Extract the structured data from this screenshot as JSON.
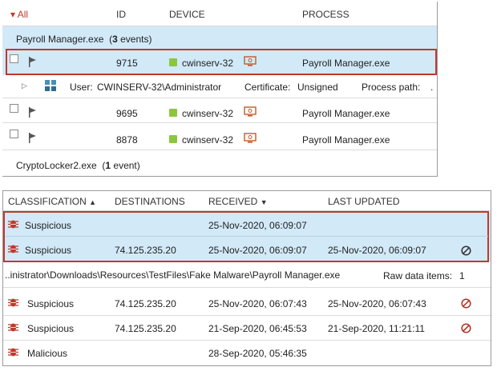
{
  "top": {
    "columns": {
      "all": "All",
      "id": "ID",
      "device": "DEVICE",
      "process": "PROCESS"
    },
    "group1": {
      "name": "Payroll Manager.exe",
      "count_prefix": "(",
      "count": "3",
      "count_suffix": " events)"
    },
    "selected_row": {
      "id": "9715",
      "device": "cwinserv-32",
      "process": "Payroll Manager.exe"
    },
    "details": {
      "user_label": "User:",
      "user_value": "CWINSERV-32\\Administrator",
      "cert_label": "Certificate:",
      "cert_value": "Unsigned",
      "path_label": "Process path:",
      "path_value": "."
    },
    "rows": [
      {
        "id": "9695",
        "device": "cwinserv-32",
        "process": "Payroll Manager.exe"
      },
      {
        "id": "8878",
        "device": "cwinserv-32",
        "process": "Payroll Manager.exe"
      }
    ],
    "group2": {
      "name": "CryptoLocker2.exe",
      "count_prefix": "(",
      "count": "1",
      "count_suffix": " event)"
    }
  },
  "bottom": {
    "columns": {
      "classification": "CLASSIFICATION",
      "destinations": "DESTINATIONS",
      "received": "RECEIVED",
      "last_updated": "LAST UPDATED"
    },
    "sel1": {
      "classification": "Suspicious",
      "destination": "",
      "received": "25-Nov-2020, 06:09:07",
      "updated": ""
    },
    "sel2": {
      "classification": "Suspicious",
      "destination": "74.125.235.20",
      "received": "25-Nov-2020, 06:09:07",
      "updated": "25-Nov-2020, 06:09:07"
    },
    "path_row": {
      "path": "..inistrator\\Downloads\\Resources\\TestFiles\\Fake Malware\\Payroll Manager.exe",
      "raw_label": "Raw data items:",
      "raw_value": "1"
    },
    "rows": [
      {
        "classification": "Suspicious",
        "destination": "74.125.235.20",
        "received": "25-Nov-2020, 06:07:43",
        "updated": "25-Nov-2020, 06:07:43"
      },
      {
        "classification": "Suspicious",
        "destination": "74.125.235.20",
        "received": "21-Sep-2020, 06:45:53",
        "updated": "21-Sep-2020, 11:21:11"
      },
      {
        "classification": "Malicious",
        "destination": "",
        "received": "28-Sep-2020, 05:46:35",
        "updated": ""
      }
    ]
  },
  "colors": {
    "highlight": "#d2e9f8",
    "selection_border": "#c0392b",
    "device_status": "#8cc63f",
    "threat_icon": "#c0392b"
  }
}
